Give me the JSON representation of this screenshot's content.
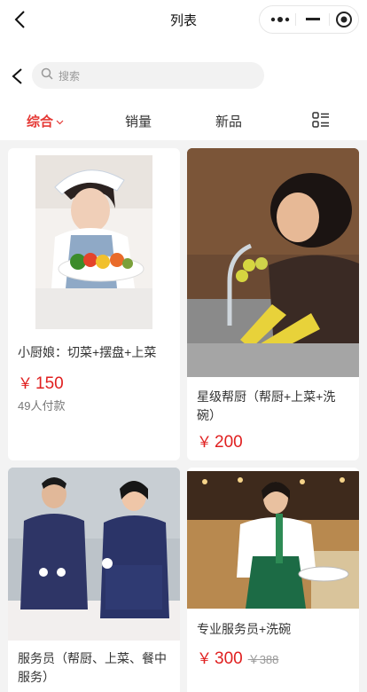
{
  "navbar": {
    "title": "列表"
  },
  "search": {
    "placeholder": "搜索"
  },
  "tabs": [
    {
      "label": "综合",
      "active": true
    },
    {
      "label": "销量",
      "active": false
    },
    {
      "label": "新品",
      "active": false
    }
  ],
  "products": [
    {
      "title": "小厨娘：切菜+摆盘+上菜",
      "currency": "￥",
      "price": "150",
      "sold": "49人付款"
    },
    {
      "title": "星级帮厨（帮厨+上菜+洗碗）",
      "currency": "￥",
      "price": "200"
    },
    {
      "title": "服务员（帮厨、上菜、餐中服务）"
    },
    {
      "title": "专业服务员+洗碗",
      "currency": "￥",
      "price": "300",
      "original_price": "￥388"
    }
  ],
  "colors": {
    "accent": "#e53935",
    "price": "#e02020"
  }
}
